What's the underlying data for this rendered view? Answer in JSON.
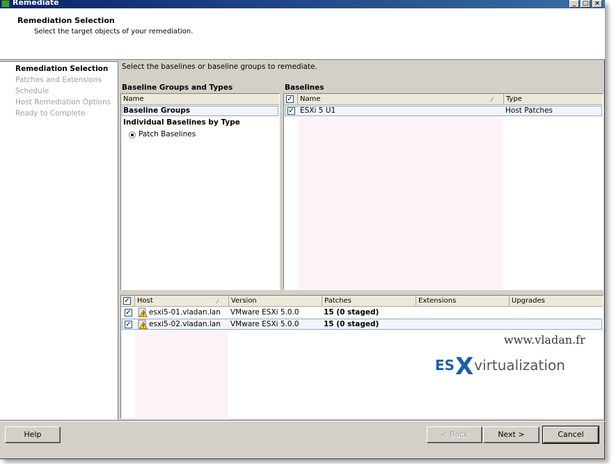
{
  "window": {
    "title": "Remediate",
    "controls": [
      "minimize",
      "maximize",
      "close"
    ]
  },
  "header": {
    "title": "Remediation Selection",
    "subtitle": "Select the target objects of your remediation."
  },
  "nav": {
    "items": [
      {
        "label": "Remediation Selection",
        "active": true
      },
      {
        "label": "Patches and Extensions",
        "active": false
      },
      {
        "label": "Schedule",
        "active": false
      },
      {
        "label": "Host Remediation Options",
        "active": false
      },
      {
        "label": "Ready to Complete",
        "active": false
      }
    ]
  },
  "main": {
    "instruction": "Select the baselines or baseline groups to remediate.",
    "groups_panel": {
      "label": "Baseline Groups and Types",
      "column": "Name",
      "rows": [
        "Baseline Groups",
        "Individual Baselines by Type"
      ],
      "radio_label": "Patch Baselines"
    },
    "baselines_panel": {
      "label": "Baselines",
      "columns": [
        "Name",
        "Type"
      ],
      "rows": [
        {
          "checked": true,
          "name": "ESXi 5 U1",
          "type": "Host Patches"
        }
      ]
    },
    "hosts_panel": {
      "columns": [
        "Host",
        "Version",
        "Patches",
        "Extensions",
        "Upgrades"
      ],
      "rows": [
        {
          "checked": true,
          "host": "esxi5-01.vladan.lan",
          "version": "VMware ESXi 5.0.0",
          "patches": "15 (0 staged)",
          "extensions": "",
          "upgrades": ""
        },
        {
          "checked": true,
          "host": "esxi5-02.vladan.lan",
          "version": "VMware ESXi 5.0.0",
          "patches": "15 (0 staged)",
          "extensions": "",
          "upgrades": ""
        }
      ]
    }
  },
  "watermark": {
    "url": "www.vladan.fr",
    "logo_es": "ES",
    "logo_x": "X",
    "logo_rest": "virtualization"
  },
  "footer": {
    "help": "Help",
    "back": "< Back",
    "next": "Next >",
    "cancel": "Cancel"
  },
  "colors": {
    "titlebar": "#0a246a",
    "selected_row": "#f2f4fb",
    "selected_border": "#8fa6c9",
    "logo_blue": "#1a5fa8"
  }
}
